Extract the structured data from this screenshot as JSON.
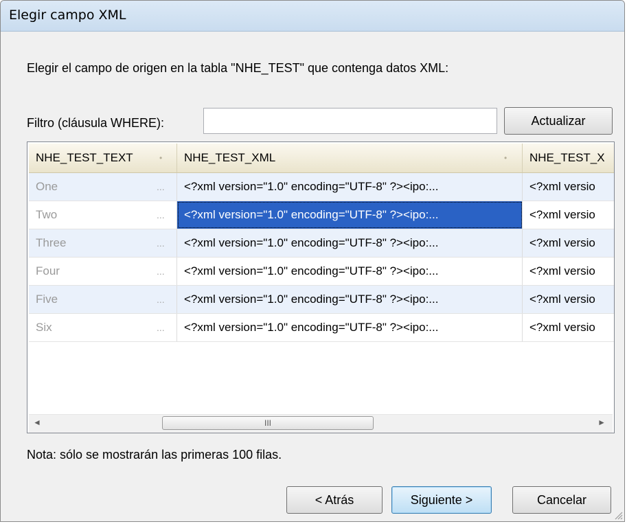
{
  "window": {
    "title": "Elegir campo XML"
  },
  "prompt": "Elegir el campo de origen en la tabla \"NHE_TEST\" que contenga datos XML:",
  "filter": {
    "label": "Filtro (cláusula WHERE):",
    "value": "",
    "refresh_label": "Actualizar"
  },
  "table": {
    "columns": [
      "NHE_TEST_TEXT",
      "NHE_TEST_XML",
      "NHE_TEST_X"
    ],
    "rows": [
      {
        "text": "One",
        "xml": "<?xml version=\"1.0\" encoding=\"UTF-8\" ?><ipo:...",
        "xml2": "<?xml versio"
      },
      {
        "text": "Two",
        "xml": "<?xml version=\"1.0\" encoding=\"UTF-8\" ?><ipo:...",
        "xml2": "<?xml versio"
      },
      {
        "text": "Three",
        "xml": "<?xml version=\"1.0\" encoding=\"UTF-8\" ?><ipo:...",
        "xml2": "<?xml versio"
      },
      {
        "text": "Four",
        "xml": "<?xml version=\"1.0\" encoding=\"UTF-8\" ?><ipo:...",
        "xml2": "<?xml versio"
      },
      {
        "text": "Five",
        "xml": "<?xml version=\"1.0\" encoding=\"UTF-8\" ?><ipo:...",
        "xml2": "<?xml versio"
      },
      {
        "text": "Six",
        "xml": "<?xml version=\"1.0\" encoding=\"UTF-8\" ?><ipo:...",
        "xml2": "<?xml versio"
      }
    ],
    "cell_ellipsis": "...",
    "selected_row": "Two",
    "selection_color": "#2a62c5"
  },
  "scrollbar": {
    "left_arrow": "◄",
    "thumb_grip": "III",
    "right_arrow": "►"
  },
  "note": "Nota: sólo se mostrarán las primeras 100 filas.",
  "buttons": {
    "back": "< Atrás",
    "next": "Siguiente >",
    "cancel": "Cancelar"
  },
  "icons": {
    "sort_dot": "•",
    "resize_grip": "resize-grip-icon"
  }
}
